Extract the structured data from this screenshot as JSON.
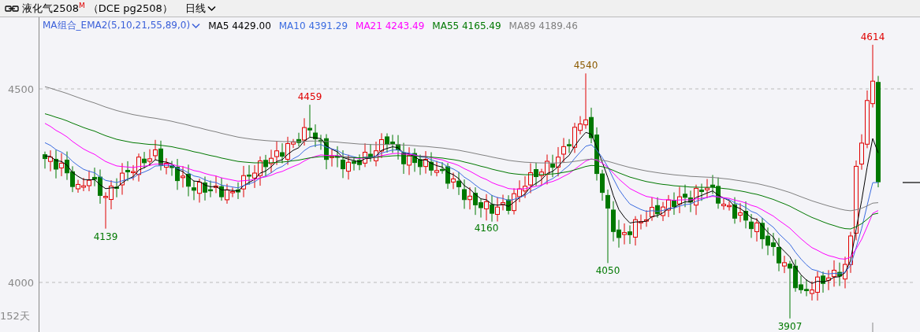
{
  "title_bar": {
    "instrument": "液化气2508",
    "badge": "M",
    "code": "（DCE pg2508）",
    "period": "日线"
  },
  "legend": [
    {
      "label": "MA组合_EMA2(5,10,21,55,89,0)",
      "kind": "selector",
      "color": "#3a5fd9"
    },
    {
      "label": "MA5 4429.00",
      "kind": "value",
      "color": "#000000"
    },
    {
      "label": "MA10 4391.29",
      "kind": "value",
      "color": "#3a6be0"
    },
    {
      "label": "MA21 4243.49",
      "kind": "value",
      "color": "#ff00ff"
    },
    {
      "label": "MA55 4165.49",
      "kind": "value",
      "color": "#007800"
    },
    {
      "label": "MA89 4189.46",
      "kind": "value",
      "color": "#808080"
    }
  ],
  "y_axis": [
    "4500",
    "4000"
  ],
  "annotations": [
    {
      "text": "4139",
      "color": "#007800"
    },
    {
      "text": "4459",
      "color": "#e00000"
    },
    {
      "text": "4160",
      "color": "#007800"
    },
    {
      "text": "4540",
      "color": "#8b5a00"
    },
    {
      "text": "4050",
      "color": "#007800"
    },
    {
      "text": "3907",
      "color": "#007800"
    },
    {
      "text": "4614",
      "color": "#e00000"
    }
  ],
  "bar_count": "152天"
}
